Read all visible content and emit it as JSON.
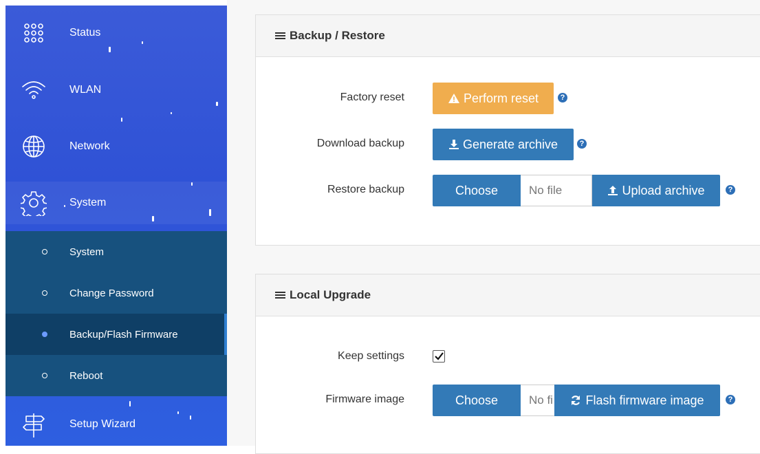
{
  "sidebar": {
    "items": [
      {
        "label": "Status",
        "icon": "dots-grid-icon"
      },
      {
        "label": "WLAN",
        "icon": "wifi-icon"
      },
      {
        "label": "Network",
        "icon": "globe-icon"
      },
      {
        "label": "System",
        "icon": "gear-icon"
      },
      {
        "label": "Setup Wizard",
        "icon": "signpost-icon"
      }
    ],
    "submenu": [
      {
        "label": "System"
      },
      {
        "label": "Change Password"
      },
      {
        "label": "Backup/Flash Firmware"
      },
      {
        "label": "Reboot"
      }
    ],
    "selected_submenu": "Backup/Flash Firmware",
    "colors": {
      "background": "#3b5bd8",
      "submenu_bg": "#17517e",
      "selected_bg": "#0f3f66"
    }
  },
  "backup_restore": {
    "title": "Backup / Restore",
    "factory_reset_label": "Factory reset",
    "perform_reset_button": "Perform reset",
    "download_backup_label": "Download backup",
    "generate_archive_button": "Generate archive",
    "restore_backup_label": "Restore backup",
    "choose_button": "Choose",
    "file_placeholder": "No file",
    "upload_archive_button": "Upload archive"
  },
  "local_upgrade": {
    "title": "Local Upgrade",
    "keep_settings_label": "Keep settings",
    "keep_settings_checked": true,
    "firmware_image_label": "Firmware image",
    "choose_button": "Choose",
    "file_placeholder": "No fi",
    "flash_button": "Flash firmware image"
  },
  "help_glyph": "?",
  "colors": {
    "warning": "#f0ad4e",
    "primary": "#337ab7",
    "help": "#2d6fb7"
  }
}
